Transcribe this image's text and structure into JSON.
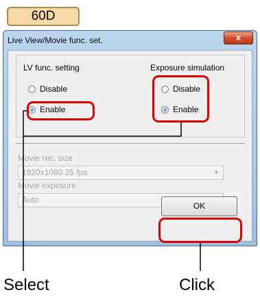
{
  "model_tag": "60D",
  "window": {
    "title": "Live View/Movie func. set.",
    "close_icon": "x"
  },
  "lv_func": {
    "heading": "LV func. setting",
    "options": [
      "Disable",
      "Enable"
    ],
    "selected": "Enable"
  },
  "exposure_sim": {
    "heading": "Exposure simulation",
    "options": [
      "Disable",
      "Enable"
    ],
    "selected": "Enable"
  },
  "movie_rec_size": {
    "label": "Movie rec. size",
    "value": "1920x1080  25 fps"
  },
  "movie_exposure": {
    "label": "Movie exposure",
    "value": "Auto"
  },
  "ok_label": "OK",
  "captions": {
    "select": "Select",
    "click": "Click"
  },
  "colors": {
    "highlight": "#e00000",
    "tag_fill": "#f5d9a6"
  }
}
